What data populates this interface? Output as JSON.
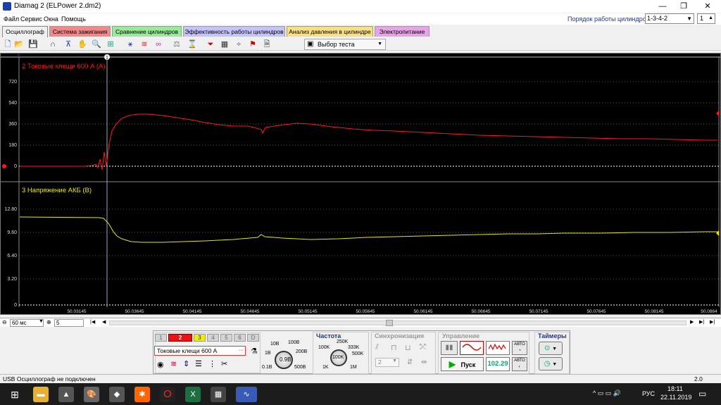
{
  "window": {
    "title": "Diamag 2 (ELPower 2.dm2)",
    "minimize": "—",
    "maximize": "❐",
    "close": "✕"
  },
  "menu": [
    "Файл",
    "Сервис",
    "Окна",
    "Помощь"
  ],
  "cylinders": {
    "label": "Порядок работы цилиндров",
    "value": "1-3-4-2",
    "spin": "1"
  },
  "tabs": [
    {
      "label": "Осциллограф",
      "color": "#f0f0f0"
    },
    {
      "label": "Система зажигания",
      "color": "#f08a8a"
    },
    {
      "label": "Сравнение цилиндров",
      "color": "#9ce89c"
    },
    {
      "label": "Эффективность работы цилиндров",
      "color": "#c4c4f6"
    },
    {
      "label": "Анализ давления в цилиндре",
      "color": "#f6e08a"
    },
    {
      "label": "Электропитание",
      "color": "#e6a6e6"
    }
  ],
  "toolbar": {
    "select_test": "Выбор теста"
  },
  "scope": {
    "channels": [
      {
        "label": "2 Токовые клещи 600 А (A)",
        "color": "#ff1a1a",
        "ticks": [
          "720",
          "540",
          "360",
          "180",
          "0"
        ]
      },
      {
        "label": "3 Напряжение АКБ (В)",
        "color": "#e8e800",
        "ticks": [
          "12.80",
          "9.60",
          "6.40",
          "3.20",
          "0"
        ]
      }
    ],
    "x_ticks": [
      "50.03145",
      "50.03645",
      "50.04145",
      "50.04645",
      "50.05145",
      "50.05645",
      "50.06145",
      "50.06645",
      "50.07145",
      "50.07645",
      "50.08145",
      "50.0864"
    ],
    "cursor_label": "1",
    "marker_label": "2"
  },
  "bottom_nav": {
    "timebase": "60 мс",
    "divisions": "5"
  },
  "panel": {
    "pages": [
      "1",
      "2",
      "3",
      "4",
      "5",
      "6"
    ],
    "pages_extra": "D",
    "active_page": "2",
    "sensor": "Токовые клещи 600 А",
    "voltage_knob": "0.9В",
    "voltage_marks": [
      "10В",
      "100В",
      "200В",
      "500В",
      "1В",
      "0.1В"
    ],
    "freq_title": "Частота",
    "freq_knob": "100K",
    "freq_marks": [
      "250K",
      "333K",
      "500K",
      "1M",
      "1K",
      "100K"
    ],
    "sync_title": "Синхронизация",
    "sync_value": "2",
    "control_title": "Управление",
    "start_label": "Пуск",
    "rpm_value": "102.29",
    "auto_label": "АВТО",
    "timers_title": "Таймеры"
  },
  "status": {
    "text": "USB Осциллограф не подключен",
    "version": "2.0"
  },
  "taskbar": {
    "time": "18:11",
    "date": "22.11.2019",
    "lang": "РУС"
  }
}
